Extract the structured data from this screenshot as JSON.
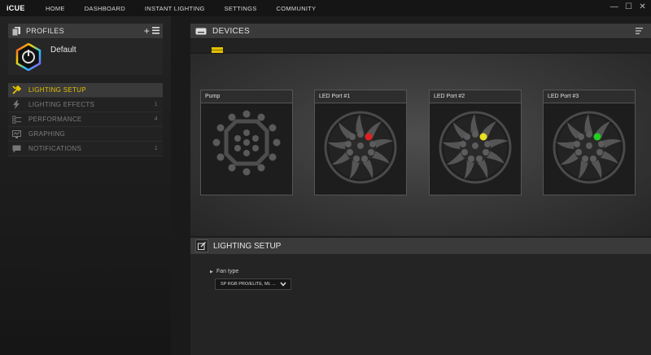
{
  "app": {
    "logo": "iCUE",
    "nav": [
      "HOME",
      "DASHBOARD",
      "INSTANT LIGHTING",
      "SETTINGS",
      "COMMUNITY"
    ]
  },
  "profiles": {
    "header": "PROFILES",
    "active_profile": "Default"
  },
  "menu": [
    {
      "label": "LIGHTING SETUP",
      "count": "",
      "active": true
    },
    {
      "label": "LIGHTING EFFECTS",
      "count": "1",
      "active": false
    },
    {
      "label": "PERFORMANCE",
      "count": "4",
      "active": false
    },
    {
      "label": "GRAPHING",
      "count": "",
      "active": false
    },
    {
      "label": "NOTIFICATIONS",
      "count": "1",
      "active": false
    }
  ],
  "devices": {
    "header": "DEVICES",
    "cards": [
      {
        "title": "Pump",
        "type": "pump",
        "led_color": ""
      },
      {
        "title": "LED Port #1",
        "type": "fan",
        "led_color": "#e02020"
      },
      {
        "title": "LED Port #2",
        "type": "fan",
        "led_color": "#e8e020"
      },
      {
        "title": "LED Port #3",
        "type": "fan",
        "led_color": "#20d020"
      }
    ]
  },
  "lighting_setup": {
    "header": "LIGHTING SETUP",
    "fan_type_label": "Fan type",
    "fan_type_value": "SP RGB PRO/ELITE, ML ..."
  },
  "colors": {
    "accent": "#e3c100",
    "panel": "#3a3a3a"
  }
}
